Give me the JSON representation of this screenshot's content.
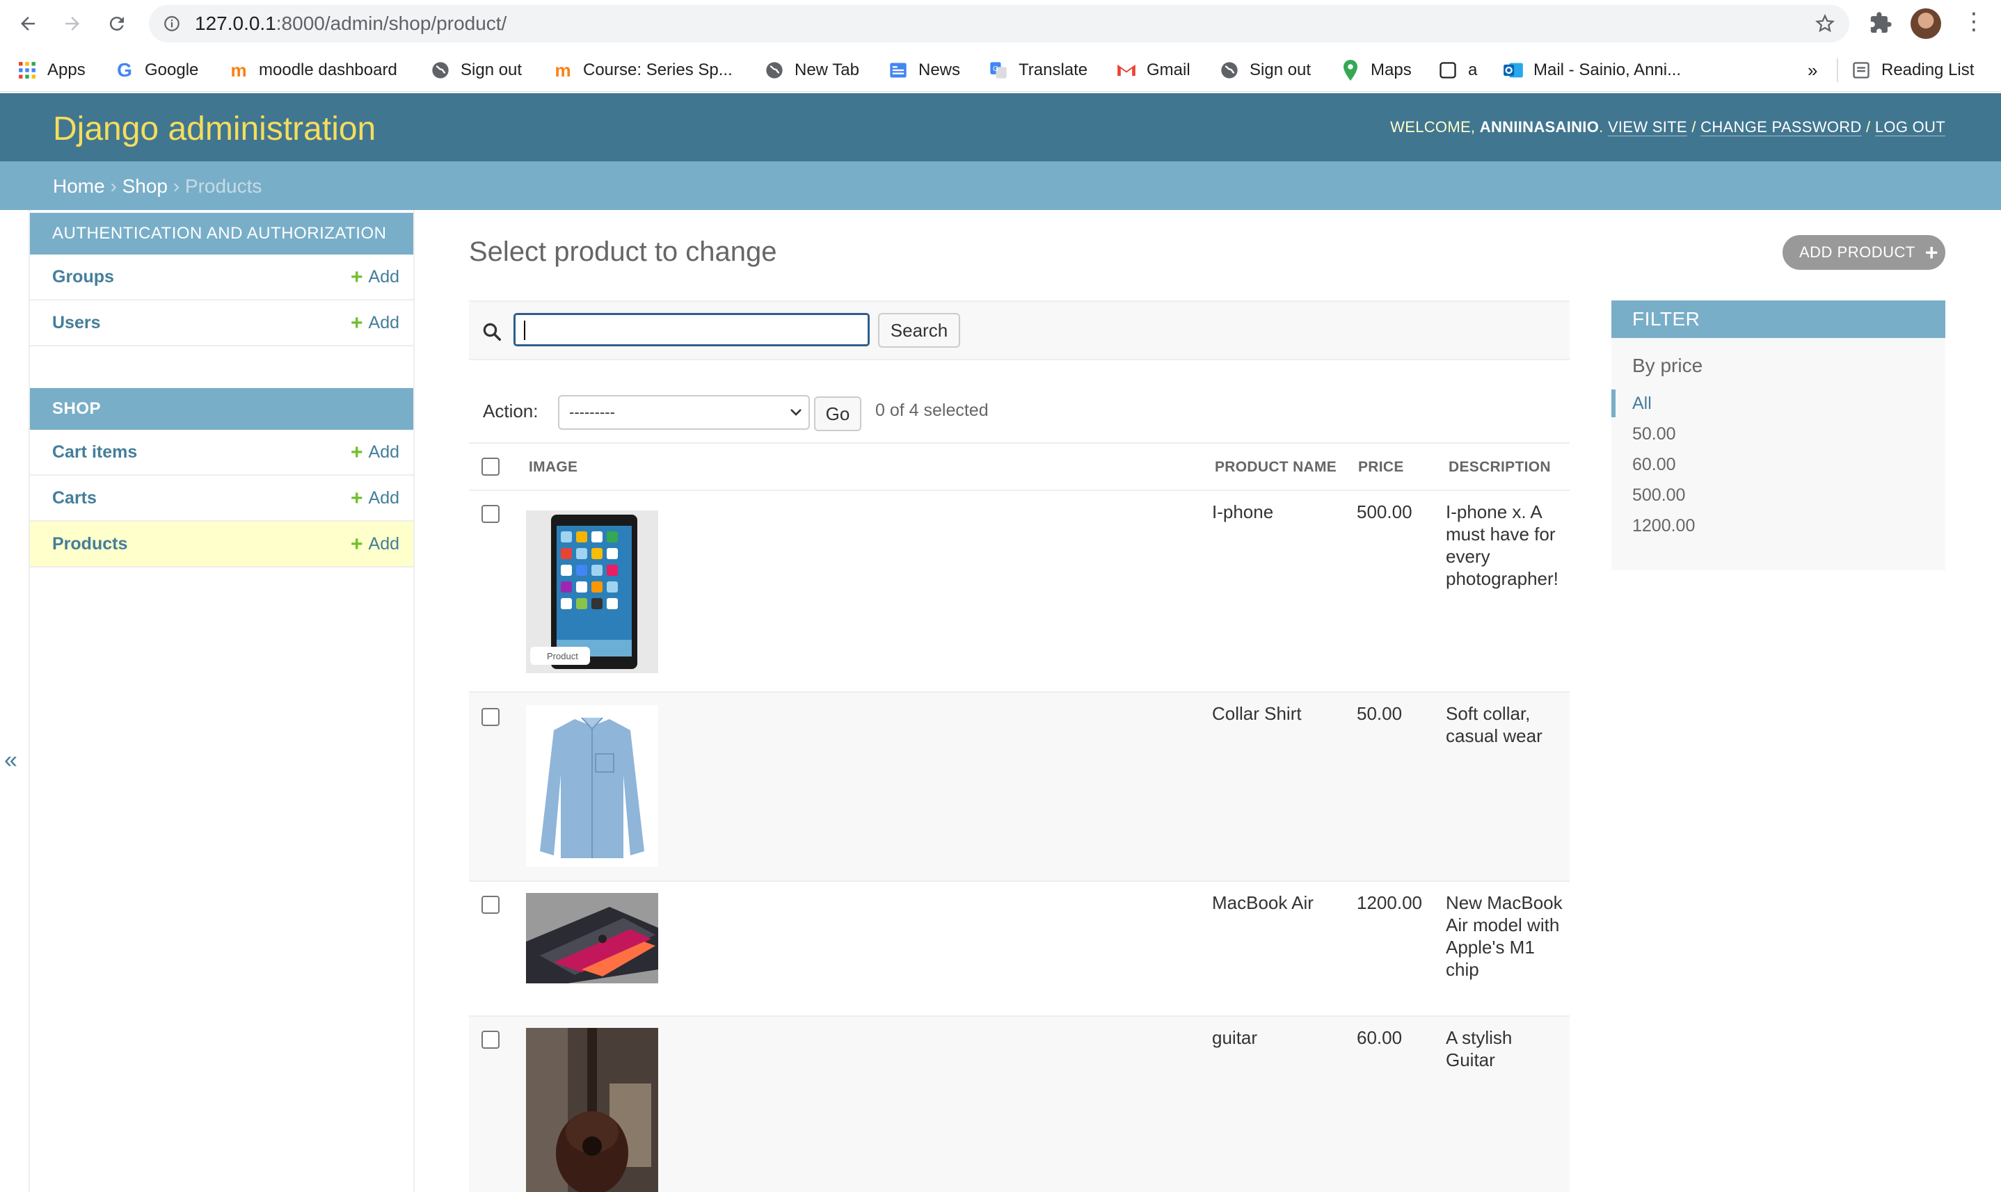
{
  "browser": {
    "url_host": "127.0.0.1",
    "url_rest": ":8000/admin/shop/product/",
    "bookmarks": [
      {
        "icon": "apps-grid-icon",
        "label": "Apps"
      },
      {
        "icon": "google-icon",
        "label": "Google"
      },
      {
        "icon": "moodle-icon",
        "label": "moodle dashboard"
      },
      {
        "icon": "globe-icon",
        "label": "Sign out"
      },
      {
        "icon": "moodle-icon",
        "label": "Course: Series Sp..."
      },
      {
        "icon": "globe-icon",
        "label": "New Tab"
      },
      {
        "icon": "news-icon",
        "label": "News"
      },
      {
        "icon": "translate-icon",
        "label": "Translate"
      },
      {
        "icon": "gmail-icon",
        "label": "Gmail"
      },
      {
        "icon": "globe-icon",
        "label": "Sign out"
      },
      {
        "icon": "maps-icon",
        "label": "Maps"
      },
      {
        "icon": "page-icon",
        "label": "a"
      },
      {
        "icon": "outlook-icon",
        "label": "Mail - Sainio, Anni..."
      }
    ],
    "more": "»",
    "reading_list": "Reading List"
  },
  "header": {
    "title": "Django administration",
    "welcome": "WELCOME,",
    "user": "ANNIINASAINIO",
    "view_site": "VIEW SITE",
    "change_password": "CHANGE PASSWORD",
    "log_out": "LOG OUT",
    "sep": "/"
  },
  "breadcrumbs": {
    "home": "Home",
    "shop": "Shop",
    "current": "Products",
    "sep": "›"
  },
  "sidebar": {
    "collapse": "«",
    "auth_caption": "AUTHENTICATION AND AUTHORIZATION",
    "auth_items": [
      {
        "label": "Groups",
        "add": "Add"
      },
      {
        "label": "Users",
        "add": "Add"
      }
    ],
    "shop_caption": "SHOP",
    "shop_items": [
      {
        "label": "Cart items",
        "add": "Add"
      },
      {
        "label": "Carts",
        "add": "Add"
      },
      {
        "label": "Products",
        "add": "Add"
      }
    ]
  },
  "content": {
    "title": "Select product to change",
    "add_button": "ADD PRODUCT",
    "search_button": "Search",
    "action_label": "Action:",
    "action_selected": "---------",
    "go_button": "Go",
    "selected_count": "0 of 4 selected"
  },
  "table": {
    "headers": [
      "IMAGE",
      "PRODUCT NAME",
      "PRICE",
      "DESCRIPTION"
    ],
    "rows": [
      {
        "name": "I-phone",
        "price": "500.00",
        "description": "I-phone x. A must have for every photographer!",
        "image": "iphone",
        "image_label": "Product"
      },
      {
        "name": "Collar Shirt",
        "price": "50.00",
        "description": "Soft collar, casual wear",
        "image": "shirt"
      },
      {
        "name": "MacBook Air",
        "price": "1200.00",
        "description": "New MacBook Air model with Apple's M1 chip",
        "image": "laptop"
      },
      {
        "name": "guitar",
        "price": "60.00",
        "description": "A stylish Guitar",
        "image": "guitar"
      }
    ]
  },
  "filter": {
    "caption": "FILTER",
    "heading": "By price",
    "options": [
      "All",
      "50.00",
      "60.00",
      "500.00",
      "1200.00"
    ],
    "selected": "All"
  },
  "colors": {
    "header_bg": "#417690",
    "breadcrumb_bg": "#79aec8",
    "title_yellow": "#f5dd5d",
    "link_blue": "#447e9b",
    "add_green": "#70bf2b",
    "current_row_bg": "#ffffcc"
  }
}
